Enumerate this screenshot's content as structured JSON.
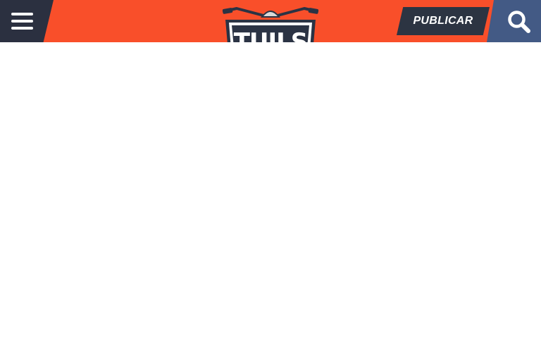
{
  "header": {
    "logo_text": "TUILS",
    "publish_label": "PUBLICAR",
    "menu_icon": "hamburger-menu-icon",
    "search_icon": "search-icon"
  },
  "colors": {
    "bar": "#f94f2a",
    "menu_bg": "#2b3040",
    "publish_bg": "#2c3442",
    "search_bg": "#435a85",
    "logo_dark": "#2b3344"
  }
}
